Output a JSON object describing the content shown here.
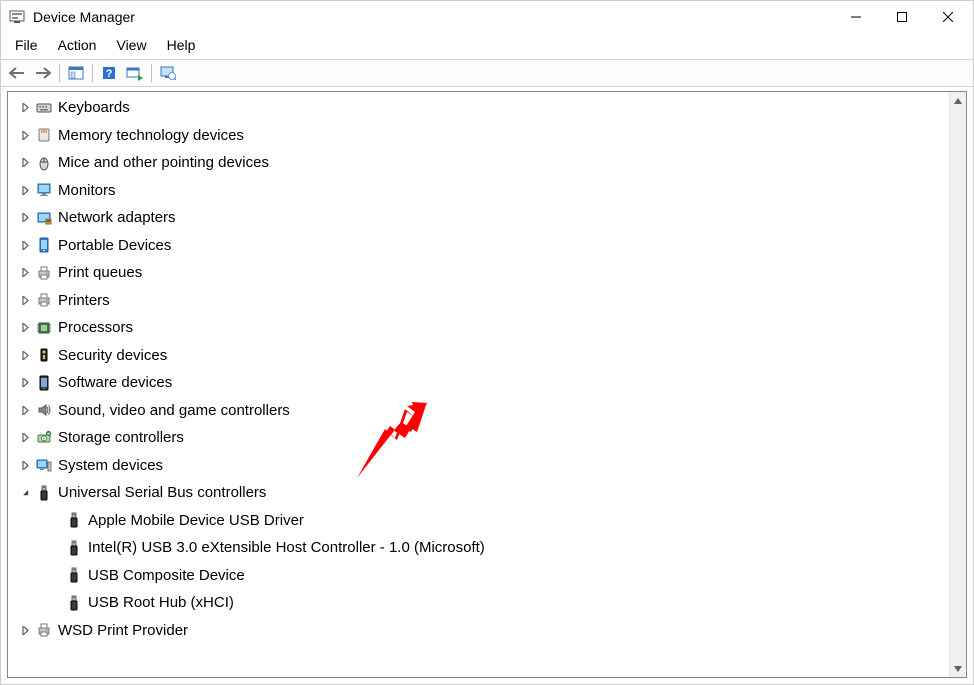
{
  "window": {
    "title": "Device Manager"
  },
  "menu": {
    "file": "File",
    "action": "Action",
    "view": "View",
    "help": "Help"
  },
  "toolbar": {
    "back": "back-icon",
    "forward": "forward-icon",
    "show_hide": "show-hide-tree-icon",
    "help_topic": "help-icon",
    "scan": "scan-hardware-icon",
    "monitor": "monitor-icon"
  },
  "tree": [
    {
      "id": "keyboards",
      "label": "Keyboards",
      "expanded": false,
      "icon": "keyboard",
      "level": 1
    },
    {
      "id": "memory-tech",
      "label": "Memory technology devices",
      "expanded": false,
      "icon": "memcard",
      "level": 1
    },
    {
      "id": "mice",
      "label": "Mice and other pointing devices",
      "expanded": false,
      "icon": "mouse",
      "level": 1
    },
    {
      "id": "monitors",
      "label": "Monitors",
      "expanded": false,
      "icon": "monitor",
      "level": 1
    },
    {
      "id": "network",
      "label": "Network adapters",
      "expanded": false,
      "icon": "network",
      "level": 1
    },
    {
      "id": "portable",
      "label": "Portable Devices",
      "expanded": false,
      "icon": "portable",
      "level": 1
    },
    {
      "id": "printqueues",
      "label": "Print queues",
      "expanded": false,
      "icon": "printer",
      "level": 1
    },
    {
      "id": "printers",
      "label": "Printers",
      "expanded": false,
      "icon": "printer",
      "level": 1
    },
    {
      "id": "processors",
      "label": "Processors",
      "expanded": false,
      "icon": "cpu",
      "level": 1
    },
    {
      "id": "security",
      "label": "Security devices",
      "expanded": false,
      "icon": "security",
      "level": 1
    },
    {
      "id": "software",
      "label": "Software devices",
      "expanded": false,
      "icon": "software",
      "level": 1
    },
    {
      "id": "sound",
      "label": "Sound, video and game controllers",
      "expanded": false,
      "icon": "sound",
      "level": 1
    },
    {
      "id": "storage",
      "label": "Storage controllers",
      "expanded": false,
      "icon": "storage",
      "level": 1
    },
    {
      "id": "system",
      "label": "System devices",
      "expanded": false,
      "icon": "system",
      "level": 1
    },
    {
      "id": "usb",
      "label": "Universal Serial Bus controllers",
      "expanded": true,
      "icon": "usb",
      "level": 1
    },
    {
      "id": "usb-apple",
      "label": "Apple Mobile Device USB Driver",
      "expanded": null,
      "icon": "usb",
      "level": 2
    },
    {
      "id": "usb-intel",
      "label": "Intel(R) USB 3.0 eXtensible Host Controller - 1.0 (Microsoft)",
      "expanded": null,
      "icon": "usb",
      "level": 2
    },
    {
      "id": "usb-composite",
      "label": "USB Composite Device",
      "expanded": null,
      "icon": "usb",
      "level": 2
    },
    {
      "id": "usb-roothub",
      "label": "USB Root Hub (xHCI)",
      "expanded": null,
      "icon": "usb",
      "level": 2
    },
    {
      "id": "wsd",
      "label": "WSD Print Provider",
      "expanded": false,
      "icon": "printer",
      "level": 1
    }
  ]
}
